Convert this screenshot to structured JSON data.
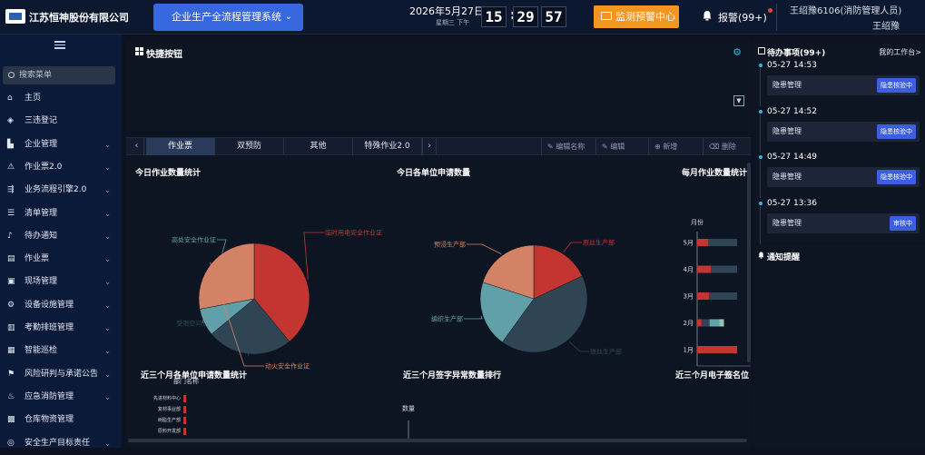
{
  "header": {
    "company": "江苏恒神股份有限公司",
    "system_select": "企业生产全流程管理系统",
    "date": "2026年5月27日",
    "weekday_time": "星期三  下午",
    "clock": {
      "h": "15",
      "m": "29",
      "s": "57"
    },
    "monitor_button": "监测预警中心",
    "alarm_label": "报警(99+)",
    "user_account": "王绍豫6106(消防管理人员)",
    "user_name": "王绍豫"
  },
  "sidebar": {
    "search_placeholder": "搜索菜单",
    "items": [
      {
        "label": "主页",
        "icon": "home-icon",
        "chevron": false
      },
      {
        "label": "三违登记",
        "icon": "layers-icon",
        "chevron": false
      },
      {
        "label": "企业管理",
        "icon": "building-icon",
        "chevron": true
      },
      {
        "label": "作业票2.0",
        "icon": "warning-icon",
        "chevron": true
      },
      {
        "label": "业务流程引擎2.0",
        "icon": "flow-icon",
        "chevron": true
      },
      {
        "label": "清单管理",
        "icon": "list-icon",
        "chevron": true
      },
      {
        "label": "待办通知",
        "icon": "bell-icon",
        "chevron": true
      },
      {
        "label": "作业票",
        "icon": "ticket-icon",
        "chevron": true
      },
      {
        "label": "现场管理",
        "icon": "site-icon",
        "chevron": true
      },
      {
        "label": "设备设施管理",
        "icon": "equipment-icon",
        "chevron": true
      },
      {
        "label": "考勤排班管理",
        "icon": "bar-chart-icon",
        "chevron": true
      },
      {
        "label": "智能巡检",
        "icon": "grid-icon",
        "chevron": true
      },
      {
        "label": "风险研判与承诺公告",
        "icon": "risk-icon",
        "chevron": true
      },
      {
        "label": "应急消防管理",
        "icon": "fire-icon",
        "chevron": true
      },
      {
        "label": "仓库物资管理",
        "icon": "warehouse-icon",
        "chevron": false
      },
      {
        "label": "安全生产目标责任",
        "icon": "target-icon",
        "chevron": true
      }
    ]
  },
  "quick": {
    "title": "快捷按钮"
  },
  "tabs": {
    "items": [
      "作业票",
      "双预防",
      "其他",
      "特殊作业2.0"
    ],
    "active": 0,
    "actions": [
      "编辑名称",
      "编辑",
      "新增",
      "删除"
    ]
  },
  "charts": {
    "today_ticket": {
      "title": "今日作业数量统计",
      "labels": [
        "高处安全作业证",
        "临时用电安全作业证",
        "受限空间安全作...",
        "动火安全作业证"
      ]
    },
    "today_unit": {
      "title": "今日各单位申请数量",
      "labels": [
        "预浸生产部",
        "原丝生产部",
        "编织生产部",
        "碳丝生产部"
      ]
    },
    "monthly": {
      "title": "每月作业数量统计",
      "y_label": "月份",
      "categories": [
        "5月",
        "4月",
        "3月",
        "2月",
        "1月"
      ],
      "ticks": [
        "0",
        "50"
      ]
    },
    "three_month_unit": {
      "title": "近三个月各单位申请数量统计",
      "y_label": "部门名称",
      "rows": [
        "先进材料中心",
        "复材事业部",
        "树脂生产部",
        "原料开发部"
      ]
    },
    "three_month_abnormal": {
      "title": "近三个月签字异常数量排行",
      "y_label": "数量"
    },
    "three_month_esign": {
      "title": "近三个月电子签名位"
    }
  },
  "chart_data": [
    {
      "type": "pie",
      "title": "今日作业数量统计",
      "slices": [
        {
          "label": "临时用电安全作业证",
          "value": 39,
          "color": "#c23531"
        },
        {
          "label": "动火安全作业证",
          "value": 25,
          "color": "#2f4554"
        },
        {
          "label": "受限空间安全作...",
          "value": 8,
          "color": "#61a0a8"
        },
        {
          "label": "高处安全作业证",
          "value": 28,
          "color": "#d48265"
        }
      ]
    },
    {
      "type": "pie",
      "title": "今日各单位申请数量",
      "slices": [
        {
          "label": "原丝生产部",
          "value": 18,
          "color": "#c23531"
        },
        {
          "label": "碳丝生产部",
          "value": 42,
          "color": "#2f4554"
        },
        {
          "label": "编织生产部",
          "value": 20,
          "color": "#61a0a8"
        },
        {
          "label": "预浸生产部",
          "value": 20,
          "color": "#d48265"
        }
      ]
    },
    {
      "type": "bar",
      "title": "每月作业数量统计",
      "categories": [
        "5月",
        "4月",
        "3月",
        "2月",
        "1月"
      ],
      "series": [
        {
          "values": [
            28,
            34,
            30,
            11,
            100
          ],
          "color": "#c23531"
        },
        {
          "values": [
            72,
            66,
            70,
            20,
            0
          ],
          "color": "#2f4554"
        },
        {
          "values": [
            0,
            0,
            0,
            24,
            0
          ],
          "color": "#61a0a8"
        },
        {
          "values": [
            0,
            0,
            0,
            12,
            0
          ],
          "color": "#91c7ae"
        }
      ],
      "xlim": [
        0,
        100
      ]
    }
  ],
  "todo": {
    "title": "待办事项(99+)",
    "link": "我的工作台>",
    "items": [
      {
        "time": "05-27 14:53",
        "name": "隐患管理",
        "status": "隐患核验中"
      },
      {
        "time": "05-27 14:52",
        "name": "隐患管理",
        "status": "隐患核验中"
      },
      {
        "time": "05-27 14:49",
        "name": "隐患管理",
        "status": "隐患核验中"
      },
      {
        "time": "05-27 13:36",
        "name": "隐患管理",
        "status": "审核中"
      }
    ]
  },
  "notice": {
    "title": "通知提醒"
  },
  "colors": {
    "accent": "#3768e0",
    "warning": "#f39423",
    "status": "#3b5fe0"
  }
}
